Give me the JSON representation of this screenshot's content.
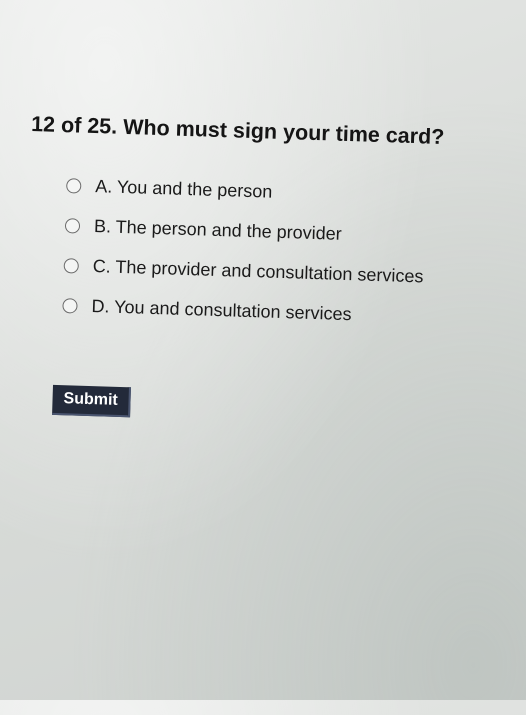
{
  "quiz": {
    "question": "12 of 25. Who must sign your time card?",
    "options": [
      {
        "label": "A. You and the person",
        "selected": false
      },
      {
        "label": "B. The person and the provider",
        "selected": false
      },
      {
        "label": "C. The provider and consultation services",
        "selected": false
      },
      {
        "label": "D. You and consultation services",
        "selected": false
      }
    ],
    "submit_label": "Submit"
  }
}
